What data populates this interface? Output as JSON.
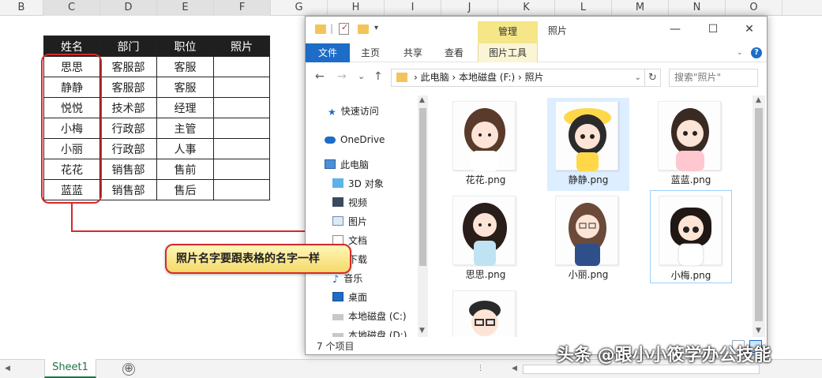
{
  "excel": {
    "columns": [
      "B",
      "C",
      "D",
      "E",
      "F",
      "G",
      "H",
      "I",
      "J",
      "K",
      "L",
      "M",
      "N",
      "O"
    ],
    "table": {
      "headers": [
        "姓名",
        "部门",
        "职位",
        "照片"
      ],
      "rows": [
        [
          "思思",
          "客服部",
          "客服",
          ""
        ],
        [
          "静静",
          "客服部",
          "客服",
          ""
        ],
        [
          "悦悦",
          "技术部",
          "经理",
          ""
        ],
        [
          "小梅",
          "行政部",
          "主管",
          ""
        ],
        [
          "小丽",
          "行政部",
          "人事",
          ""
        ],
        [
          "花花",
          "销售部",
          "售前",
          ""
        ],
        [
          "蓝蓝",
          "销售部",
          "售后",
          ""
        ]
      ]
    },
    "sheet_tab": "Sheet1",
    "add_sheet_glyph": "⊕"
  },
  "callout": {
    "text": "照片名字要跟表格的名字一样",
    "border_color": "#d42a2a"
  },
  "explorer": {
    "context_tab": "管理",
    "title": "照片",
    "ribbon_tabs": [
      "文件",
      "主页",
      "共享",
      "查看",
      "图片工具"
    ],
    "nav_back": "←",
    "nav_forward": "→",
    "nav_down": "⌄",
    "nav_up": "↑",
    "address": "›  此电脑  ›  本地磁盘 (F:)  ›  照片",
    "search_placeholder": "搜索\"照片\"",
    "sidebar": [
      {
        "label": "快速访问",
        "icon": "star-icon"
      },
      {
        "label": "OneDrive",
        "icon": "cloud-icon"
      },
      {
        "label": "此电脑",
        "icon": "computer-icon"
      },
      {
        "label": "3D 对象",
        "icon": "cube-icon"
      },
      {
        "label": "视频",
        "icon": "video-icon"
      },
      {
        "label": "图片",
        "icon": "picture-icon"
      },
      {
        "label": "文档",
        "icon": "document-icon"
      },
      {
        "label": "下载",
        "icon": "download-icon"
      },
      {
        "label": "音乐",
        "icon": "music-icon"
      },
      {
        "label": "桌面",
        "icon": "desktop-icon"
      },
      {
        "label": "本地磁盘 (C:)",
        "icon": "drive-icon"
      },
      {
        "label": "本地磁盘 (D:)",
        "icon": "drive-icon"
      }
    ],
    "files": [
      {
        "name": "花花.png",
        "hair": "#5a3a2a",
        "shirt": "#ffffff",
        "selected": false
      },
      {
        "name": "静静.png",
        "hair": "#2b2b2b",
        "shirt": "#ffd84a",
        "selected": true
      },
      {
        "name": "蓝蓝.png",
        "hair": "#3a2a24",
        "shirt": "#ffc7cf",
        "selected": false
      },
      {
        "name": "思思.png",
        "hair": "#2a1e1a",
        "shirt": "#bfe3f2",
        "selected": false
      },
      {
        "name": "小丽.png",
        "hair": "#6b4a3a",
        "shirt": "#2f4f8a",
        "selected": false
      },
      {
        "name": "小梅.png",
        "hair": "#1f1714",
        "shirt": "#ffffff",
        "selected": false,
        "focused": true
      },
      {
        "name": "",
        "hair": "#2a2a2a",
        "shirt": "#ffffff",
        "selected": false
      }
    ],
    "status": "7 个项目",
    "accent": "#1d6cc8"
  },
  "watermark": "头条 @跟小小筱学办公技能"
}
